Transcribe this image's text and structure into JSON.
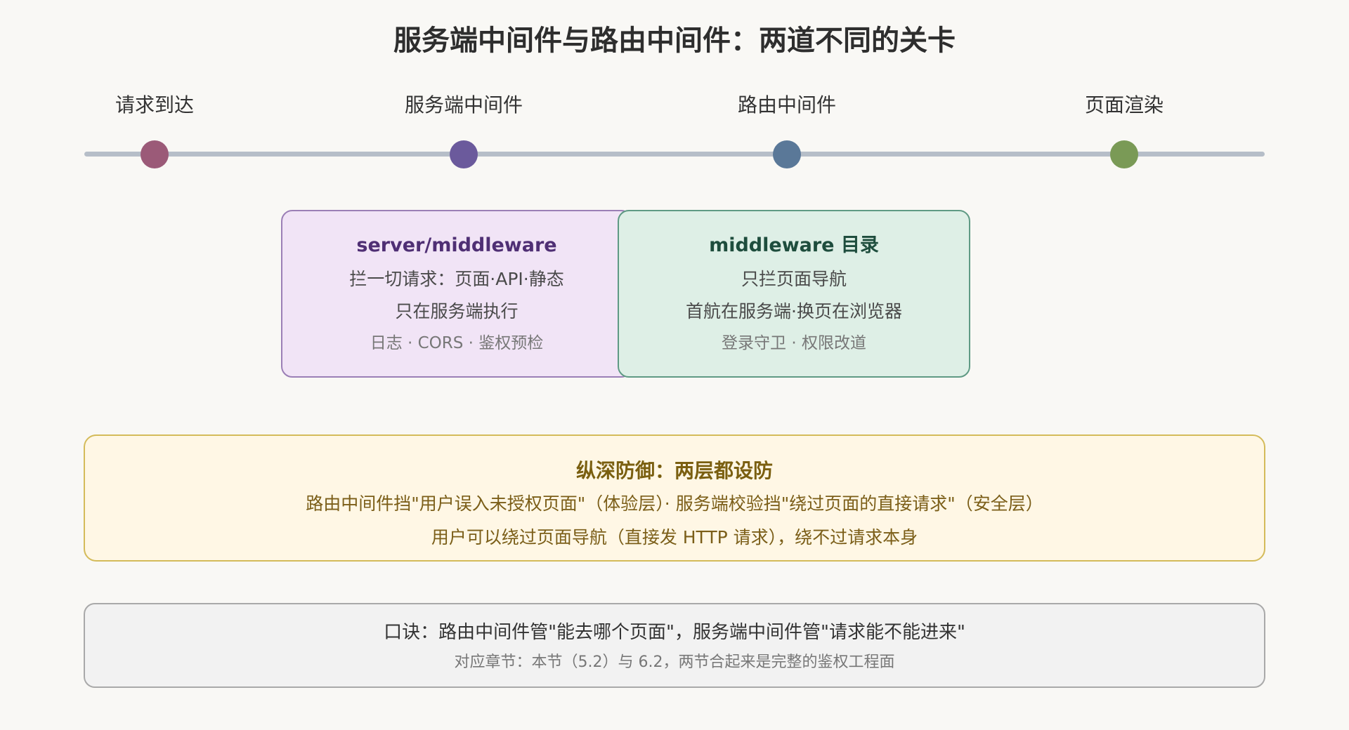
{
  "title": "服务端中间件与路由中间件：两道不同的关卡",
  "timeline": {
    "stages": [
      {
        "label": "请求到达",
        "color": "#9b5a78"
      },
      {
        "label": "服务端中间件",
        "color": "#6b5a9c"
      },
      {
        "label": "路由中间件",
        "color": "#5a7898"
      },
      {
        "label": "页面渲染",
        "color": "#7a9a56"
      }
    ]
  },
  "server_box": {
    "title": "server/middleware",
    "line1": "拦一切请求：页面·API·静态",
    "line2": "只在服务端执行",
    "note": "日志 · CORS · 鉴权预检"
  },
  "route_box": {
    "title": "middleware 目录",
    "line1": "只拦页面导航",
    "line2": "首航在服务端·换页在浏览器",
    "note": "登录守卫 · 权限改道"
  },
  "defense": {
    "title": "纵深防御：两层都设防",
    "line1": "路由中间件挡\"用户误入未授权页面\"（体验层）· 服务端校验挡\"绕过页面的直接请求\"（安全层）",
    "line2": "用户可以绕过页面导航（直接发 HTTP 请求），绕不过请求本身"
  },
  "mnemonic": {
    "main": "口诀：路由中间件管\"能去哪个页面\"，服务端中间件管\"请求能不能进来\"",
    "sub": "对应章节：本节（5.2）与 6.2，两节合起来是完整的鉴权工程面"
  }
}
